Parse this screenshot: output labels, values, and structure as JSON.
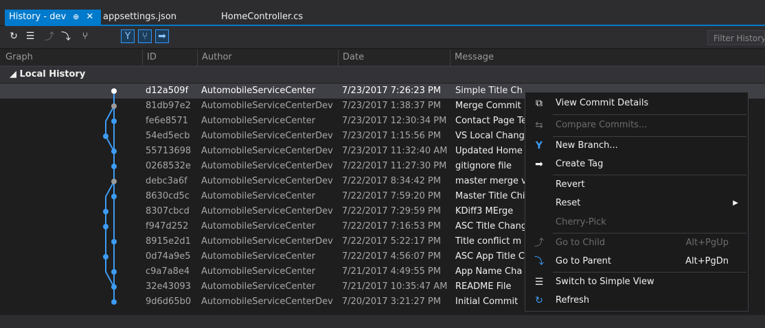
{
  "tabs": [
    {
      "label": "History - dev",
      "pin": "⊕",
      "close": "✕"
    },
    {
      "label": "appsettings.json"
    },
    {
      "label": "HomeController.cs"
    }
  ],
  "toolbar": {
    "filter_placeholder": "Filter History"
  },
  "columns": [
    "Graph",
    "ID",
    "Author",
    "Date",
    "Message"
  ],
  "group_label": "◢ Local History",
  "commits": [
    {
      "id": "d12a509f",
      "author": "AutomobileServiceCenter",
      "date": "7/23/2017 7:26:23 PM",
      "message": "Simple Title Ch"
    },
    {
      "id": "81db97e2",
      "author": "AutomobileServiceCenterDev",
      "date": "7/23/2017 1:38:37 PM",
      "message": "Merge Commit"
    },
    {
      "id": "fe6e8571",
      "author": "AutomobileServiceCenter",
      "date": "7/23/2017 12:30:34 PM",
      "message": "Contact Page Te"
    },
    {
      "id": "54ed5ecb",
      "author": "AutomobileServiceCenterDev",
      "date": "7/23/2017 1:15:56 PM",
      "message": "VS Local Chang"
    },
    {
      "id": "55713698",
      "author": "AutomobileServiceCenterDev",
      "date": "7/23/2017 11:32:40 AM",
      "message": "Updated Home"
    },
    {
      "id": "0268532e",
      "author": "AutomobileServiceCenterDev",
      "date": "7/22/2017 11:27:30 PM",
      "message": "gitignore file"
    },
    {
      "id": "debc3a6f",
      "author": "AutomobileServiceCenterDev",
      "date": "7/22/2017 8:34:42 PM",
      "message": "master merge v"
    },
    {
      "id": "8630cd5c",
      "author": "AutomobileServiceCenter",
      "date": "7/22/2017 7:59:20 PM",
      "message": "Master Title Chi"
    },
    {
      "id": "8307cbcd",
      "author": "AutomobileServiceCenterDev",
      "date": "7/22/2017 7:29:59 PM",
      "message": "KDiff3 MErge"
    },
    {
      "id": "f947d252",
      "author": "AutomobileServiceCenter",
      "date": "7/22/2017 7:16:53 PM",
      "message": "ASC Title Chang"
    },
    {
      "id": "8915e2d1",
      "author": "AutomobileServiceCenterDev",
      "date": "7/22/2017 5:22:17 PM",
      "message": "Title conflict m"
    },
    {
      "id": "0d74a9e5",
      "author": "AutomobileServiceCenter",
      "date": "7/22/2017 4:56:07 PM",
      "message": "ASC App Title C"
    },
    {
      "id": "c9a7a8e4",
      "author": "AutomobileServiceCenter",
      "date": "7/21/2017 4:49:55 PM",
      "message": "App Name Cha"
    },
    {
      "id": "32e43093",
      "author": "AutomobileServiceCenter",
      "date": "7/21/2017 10:35:47 AM",
      "message": "README File"
    },
    {
      "id": "9d6d65b0",
      "author": "AutomobileServiceCenterDev",
      "date": "7/20/2017 3:21:27 PM",
      "message": "Initial Commit"
    }
  ],
  "context_menu": {
    "view_details": "View Commit Details",
    "compare": "Compare Commits...",
    "new_branch": "New Branch...",
    "create_tag": "Create Tag",
    "revert": "Revert",
    "reset": "Reset",
    "cherry_pick": "Cherry-Pick",
    "go_child": "Go to Child",
    "go_child_shortcut": "Alt+PgUp",
    "go_parent": "Go to Parent",
    "go_parent_shortcut": "Alt+PgDn",
    "simple_view": "Switch to Simple View",
    "refresh": "Refresh"
  },
  "colors": {
    "accent": "#007acc",
    "graph": "#3d9cf5",
    "merge_node": "#9a9a9a",
    "head_node": "#ffffff"
  }
}
